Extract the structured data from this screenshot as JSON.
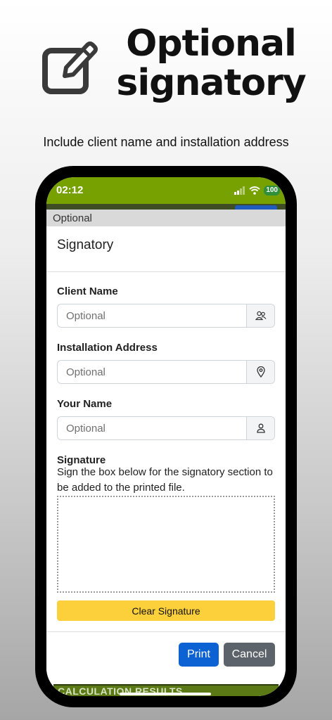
{
  "hero": {
    "title_line1": "Optional",
    "title_line2": "signatory",
    "subtitle": "Include client name and installation address",
    "icon": "edit-square-icon"
  },
  "status_bar": {
    "time": "02:12",
    "battery": "100",
    "color": "#76a100"
  },
  "section_header": "Optional",
  "modal": {
    "title": "Signatory",
    "fields": [
      {
        "label": "Client Name",
        "placeholder": "Optional",
        "icon": "people-icon"
      },
      {
        "label": "Installation Address",
        "placeholder": "Optional",
        "icon": "location-pin-icon"
      },
      {
        "label": "Your Name",
        "placeholder": "Optional",
        "icon": "person-icon"
      }
    ],
    "signature": {
      "label": "Signature",
      "description": "Sign the box below for the signatory section to be added to the printed file.",
      "clear_label": "Clear Signature"
    },
    "print_label": "Print",
    "cancel_label": "Cancel"
  },
  "background_bar": "CALCULATION RESULTS",
  "colors": {
    "primary": "#0d62d3",
    "secondary": "#5c636a",
    "warning": "#fcd03a",
    "header_green": "#76a100"
  }
}
